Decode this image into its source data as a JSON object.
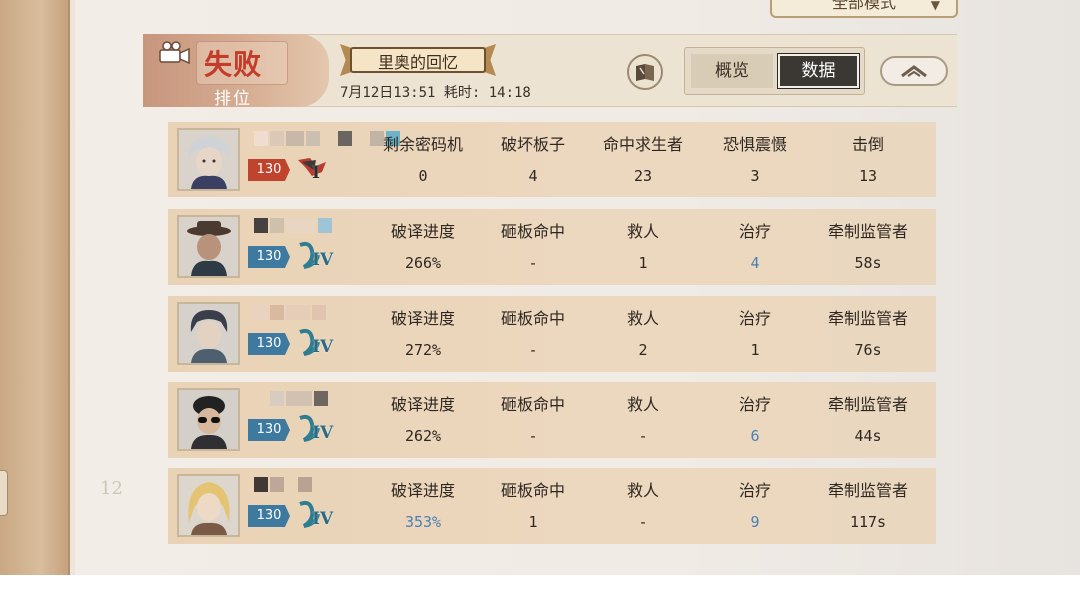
{
  "header": {
    "mode_dropdown": "全部模式",
    "result": "失败",
    "rank_label": "排位",
    "map_name": "里奥的回忆",
    "match_time": "7月12日13:51 耗时: 14:18",
    "tabs": {
      "overview": "概览",
      "data": "数据"
    }
  },
  "hunter": {
    "level": "130",
    "stats": [
      {
        "label": "剩余密码机",
        "value": "0"
      },
      {
        "label": "破坏板子",
        "value": "4"
      },
      {
        "label": "命中求生者",
        "value": "23"
      },
      {
        "label": "恐惧震慑",
        "value": "3"
      },
      {
        "label": "击倒",
        "value": "13"
      }
    ]
  },
  "survivors": [
    {
      "level": "130",
      "rank": "IV",
      "stats": [
        {
          "label": "破译进度",
          "value": "266%"
        },
        {
          "label": "砸板命中",
          "value": "-"
        },
        {
          "label": "救人",
          "value": "1"
        },
        {
          "label": "治疗",
          "value": "4"
        },
        {
          "label": "牵制监管者",
          "value": "58s"
        }
      ]
    },
    {
      "level": "130",
      "rank": "IV",
      "stats": [
        {
          "label": "破译进度",
          "value": "272%"
        },
        {
          "label": "砸板命中",
          "value": "-"
        },
        {
          "label": "救人",
          "value": "2"
        },
        {
          "label": "治疗",
          "value": "1"
        },
        {
          "label": "牵制监管者",
          "value": "76s"
        }
      ]
    },
    {
      "level": "130",
      "rank": "IV",
      "stats": [
        {
          "label": "破译进度",
          "value": "262%"
        },
        {
          "label": "砸板命中",
          "value": "-"
        },
        {
          "label": "救人",
          "value": "-"
        },
        {
          "label": "治疗",
          "value": "6"
        },
        {
          "label": "牵制监管者",
          "value": "44s"
        }
      ]
    },
    {
      "level": "130",
      "rank": "IV",
      "stats": [
        {
          "label": "破译进度",
          "value": "353%"
        },
        {
          "label": "砸板命中",
          "value": "1"
        },
        {
          "label": "救人",
          "value": "-"
        },
        {
          "label": "治疗",
          "value": "9"
        },
        {
          "label": "牵制监管者",
          "value": "117s"
        }
      ]
    }
  ],
  "page_mark": "12",
  "colors": {
    "highlight": "#4c7fb5",
    "defeat": "#c33c2a",
    "active_tab": "#3b3834"
  }
}
